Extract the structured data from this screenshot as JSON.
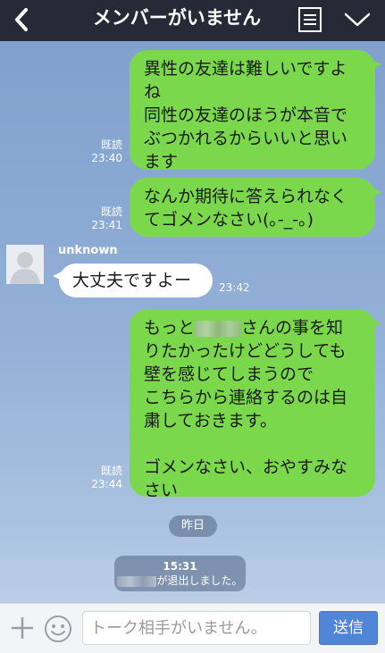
{
  "header": {
    "title": "メンバーがいません"
  },
  "messages": {
    "m1": {
      "line1": "異性の友達は難しいですよ",
      "line2": "ね",
      "line3": "同性の友達のほうが本音で",
      "line4": "ぶつかれるからいいと思い",
      "line5": "ます",
      "read": "既読",
      "time": "23:40"
    },
    "m2": {
      "line1": "なんか期待に答えられなく",
      "line2": "てゴメンなさい(｡-_-｡)",
      "read": "既読",
      "time": "23:41"
    },
    "m3": {
      "sender": "unknown",
      "text": "大丈夫ですよー",
      "time": "23:42"
    },
    "m4": {
      "line1_a": "もっと",
      "line1_b": "さんの事を知",
      "line2": "りたかったけどどうしても",
      "line3": "壁を感じてしまうので",
      "line4": "こちらから連絡するのは自",
      "line5": "粛しておきます。",
      "line6": "ゴメンなさい、おやすみな",
      "line7": "さい",
      "read": "既読",
      "time": "23:44"
    }
  },
  "date_divider": "昨日",
  "system": {
    "time": "15:31",
    "text": "が退出しました。"
  },
  "composer": {
    "placeholder": "トーク相手がいません。",
    "send_label": "送信"
  }
}
